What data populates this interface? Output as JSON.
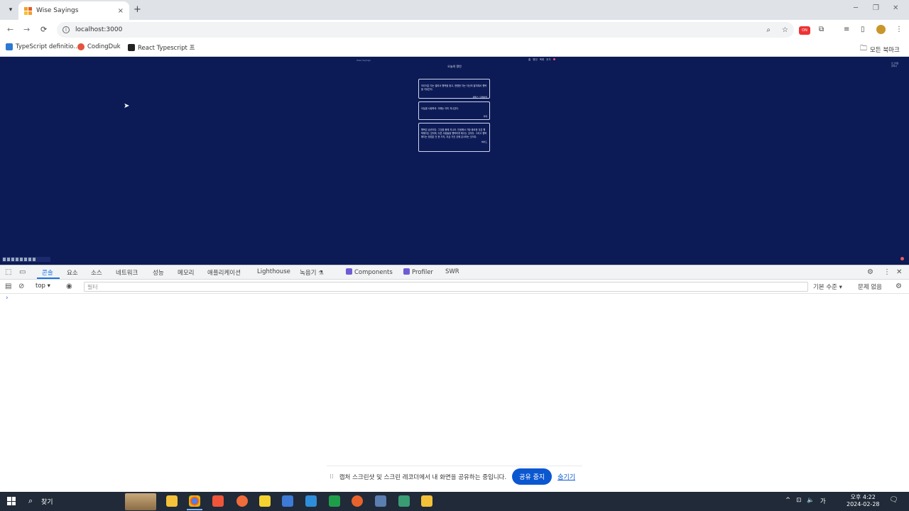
{
  "browser": {
    "tab_dropdown_icon": "chevron-down-icon",
    "tab_title": "Wise Sayings",
    "tab_close": "×",
    "new_tab": "+",
    "win_min": "─",
    "win_max": "❐",
    "win_close": "✕",
    "back": "←",
    "forward": "→",
    "reload": "⟳",
    "url": "localhost:3000",
    "zoom_icon": "⌕",
    "star_icon": "☆",
    "ext_badge": "ON",
    "puzzle_icon": "⧉",
    "media_icon": "≡",
    "sidepanel_icon": "▯",
    "menu_icon": "⋮"
  },
  "bookmarks": {
    "items": [
      {
        "label": "TypeScript definitio...",
        "color": "#2b79d1"
      },
      {
        "label": "CodingDuk",
        "color": "#e5533d"
      },
      {
        "label": "React Typescript 프",
        "color": "#222222"
      }
    ],
    "all_bookmarks": "모든 북마크"
  },
  "app": {
    "brand": "Wise Sayings",
    "nav": [
      "홈",
      "명언",
      "목록",
      "추가"
    ],
    "user": [
      "로그아웃",
      "관리자"
    ],
    "page_title": "오늘의 명언",
    "quotes": [
      {
        "text": "어리석은 자는 멀리서 행복을 찾고, 현명한 자는 자신의 발치에서 행복을 키워간다.",
        "author": "제임스 오펜하임"
      },
      {
        "text": "오늘을 사랑하라. 어제는 이미 지나갔다.",
        "author": "괴테"
      },
      {
        "text": "행복은 습관이다. 그것을 몸에 지니라. 인생에서 가장 중요한 것은 행복해지는 것이며, 다른 사람들을 행복하게 해주는 것이다. 그리고 행복해지는 방법은 단 한 가지, 지금 가진 것에 감사하는 것이다.",
        "author": "허버드"
      }
    ]
  },
  "devtools": {
    "inspect_icon": "⬚",
    "device_icon": "▭",
    "tabs": [
      "콘솔",
      "요소",
      "소스",
      "네트워크",
      "성능",
      "메모리",
      "애플리케이션",
      "Lighthouse",
      "녹음기 ⚗",
      "Components",
      "Profiler",
      "SWR"
    ],
    "settings_icon": "⚙",
    "more_icon": "⋮",
    "close_icon": "✕",
    "sidebar_icon": "▤",
    "clear_icon": "⊘",
    "context": "top",
    "eye_icon": "◉",
    "filter_placeholder": "필터",
    "levels": "기본 수준 ▾",
    "issues": "문제 없음",
    "gear_icon": "⚙",
    "prompt": "›"
  },
  "sharebar": {
    "grip": "⁞⁞",
    "text": "캡처 스크린샷 및 스크린 레코더에서 내 화면을 공유하는 중입니다.",
    "stop": "공유 중지",
    "hide": "숨기기"
  },
  "taskbar": {
    "search_icon": "⌕",
    "search_label": "찾기",
    "tray": [
      "^",
      "⊡",
      "🔈",
      "가"
    ],
    "time": "오후 4:22",
    "date": "2024-02-28",
    "notif": "🗨"
  }
}
